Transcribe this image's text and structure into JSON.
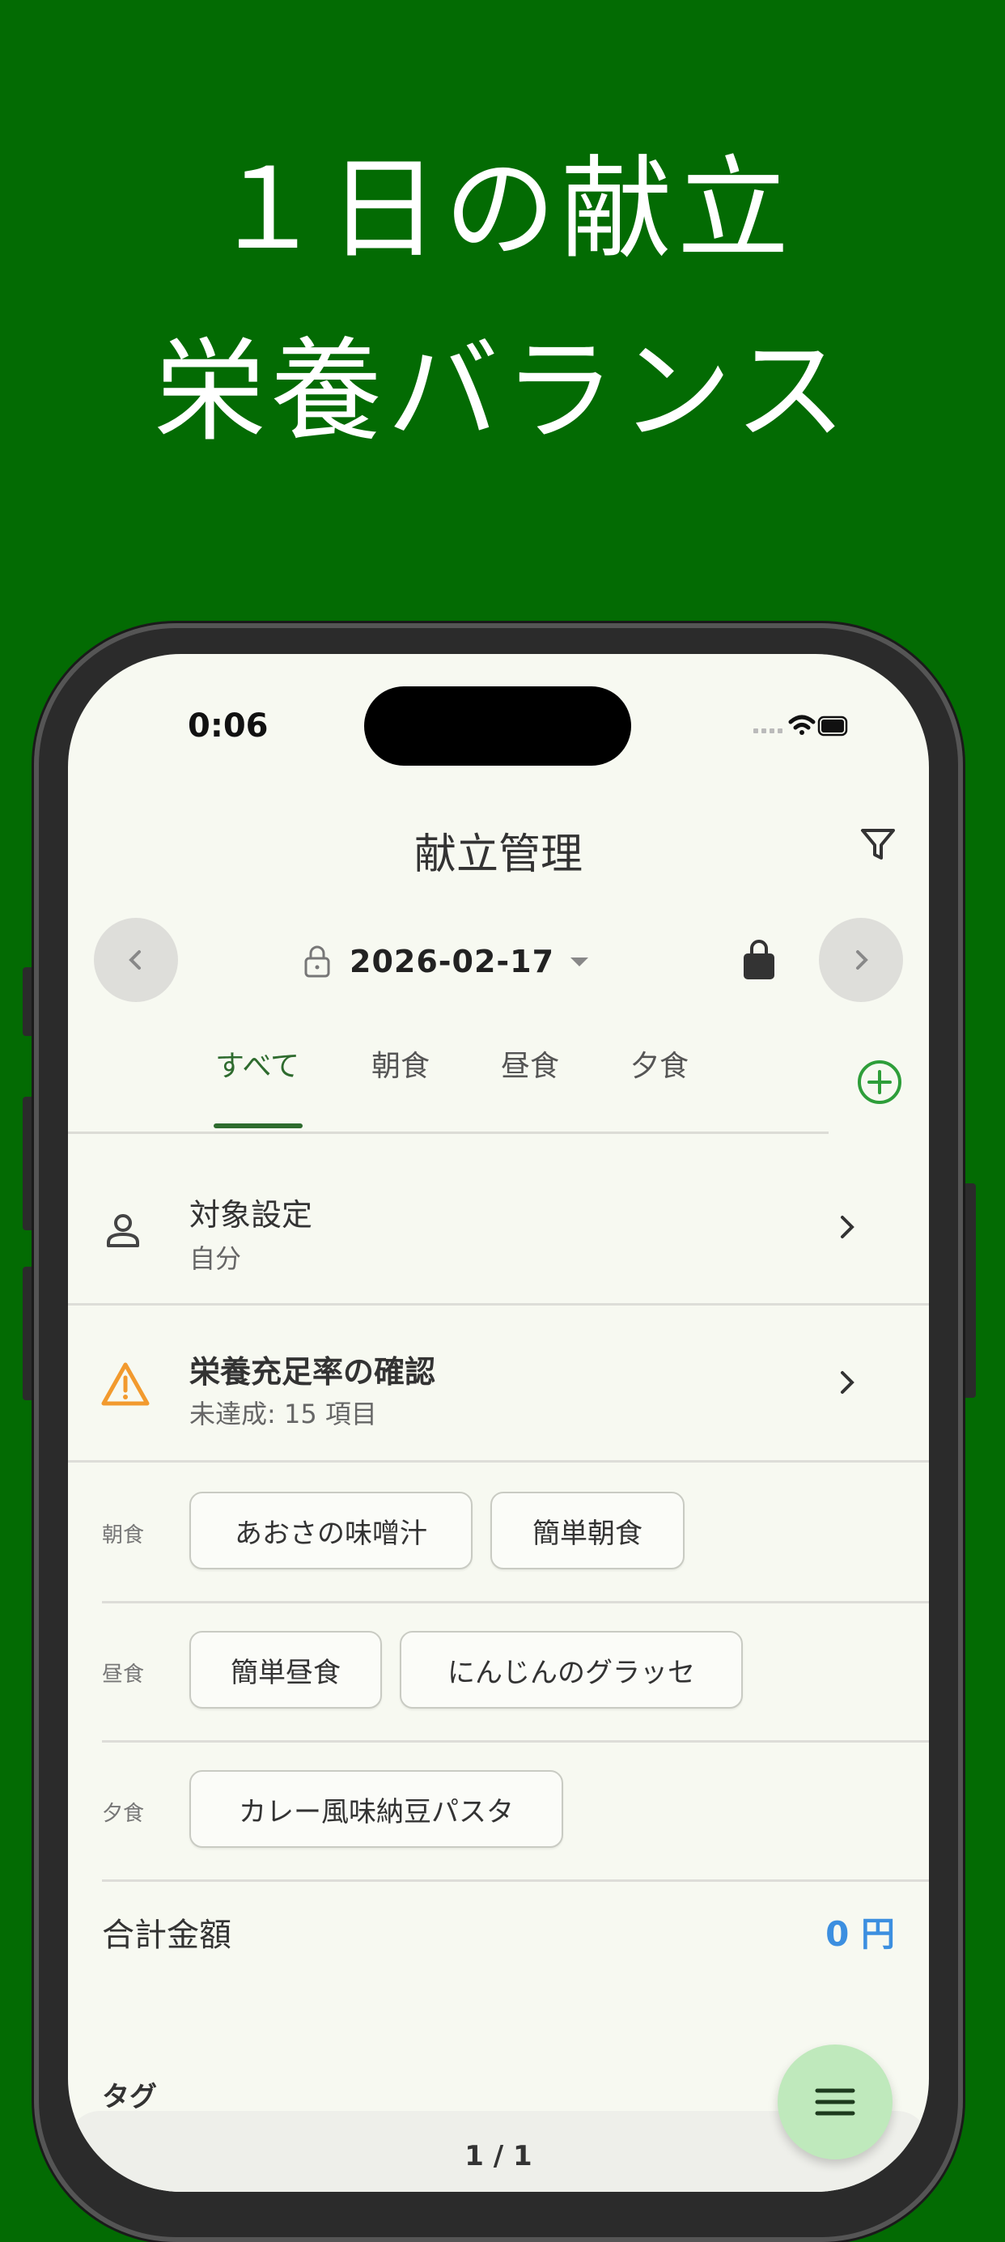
{
  "promo": {
    "headline_line1": "１日の献立",
    "headline_line2": "栄養バランス"
  },
  "status_bar": {
    "time": "0:06"
  },
  "nav": {
    "title": "献立管理",
    "filter_icon": "filter-icon"
  },
  "date_bar": {
    "date": "2026-02-17",
    "lock_icon": "lock-icon",
    "bag_icon": "shopping-bag-icon"
  },
  "tabs": [
    {
      "label": "すべて",
      "active": true
    },
    {
      "label": "朝食",
      "active": false
    },
    {
      "label": "昼食",
      "active": false
    },
    {
      "label": "夕食",
      "active": false
    }
  ],
  "target_setting": {
    "title": "対象設定",
    "subtitle": "自分"
  },
  "nutrition_check": {
    "title": "栄養充足率の確認",
    "subtitle": "未達成: 15 項目"
  },
  "meals": [
    {
      "label": "朝食",
      "dishes": [
        "あおさの味噌汁",
        "簡単朝食"
      ]
    },
    {
      "label": "昼食",
      "dishes": [
        "簡単昼食",
        "にんじんのグラッセ"
      ]
    },
    {
      "label": "夕食",
      "dishes": [
        "カレー風味納豆パスタ"
      ]
    }
  ],
  "total": {
    "label": "合計金額",
    "value": "0 円"
  },
  "tags": {
    "label": "タグ"
  },
  "pager": {
    "text": "1 / 1"
  },
  "colors": {
    "background": "#036B03",
    "accent": "#2E6B2E",
    "price": "#3C8FE0",
    "warning": "#F29A2E",
    "fab": "#BFE9BC"
  }
}
